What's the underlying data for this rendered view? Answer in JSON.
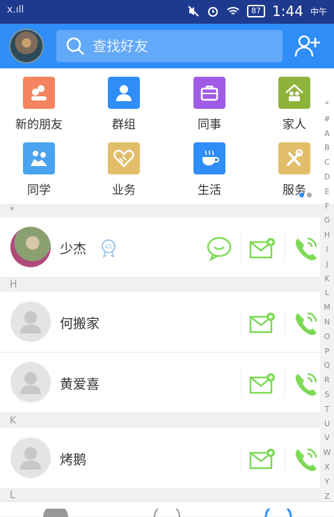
{
  "status": {
    "signal_text": "x.ıll",
    "battery": "87",
    "time": "1:44",
    "ampm": "中午"
  },
  "search": {
    "placeholder": "查找好友"
  },
  "categories": [
    {
      "label": "新的朋友",
      "icon": "new-friends-icon",
      "color": "#f4845f"
    },
    {
      "label": "群组",
      "icon": "group-icon",
      "color": "#2f8df7"
    },
    {
      "label": "同事",
      "icon": "colleague-icon",
      "color": "#a05be6"
    },
    {
      "label": "家人",
      "icon": "family-icon",
      "color": "#8db33a"
    },
    {
      "label": "同学",
      "icon": "classmate-icon",
      "color": "#4aa3ef"
    },
    {
      "label": "业务",
      "icon": "business-icon",
      "color": "#e2be6b"
    },
    {
      "label": "生活",
      "icon": "life-icon",
      "color": "#2f8df7"
    },
    {
      "label": "服务",
      "icon": "service-icon",
      "color": "#e2be6b"
    }
  ],
  "sections": {
    "star": "*",
    "h": "H",
    "k": "K",
    "l": "L"
  },
  "contacts": [
    {
      "name": "少杰",
      "vip": "V1"
    },
    {
      "name": "何搬家"
    },
    {
      "name": "黄爱喜"
    },
    {
      "name": "烤鹅"
    }
  ],
  "index_letters": [
    "*",
    "#",
    "A",
    "B",
    "C",
    "D",
    "E",
    "F",
    "G",
    "H",
    "I",
    "J",
    "K",
    "L",
    "M",
    "N",
    "O",
    "P",
    "Q",
    "R",
    "S",
    "T",
    "U",
    "V",
    "W",
    "X",
    "Y",
    "Z"
  ],
  "colors": {
    "header": "#2f8df7",
    "statusbar": "#1e3a8f",
    "green_action": "#7ed957"
  }
}
